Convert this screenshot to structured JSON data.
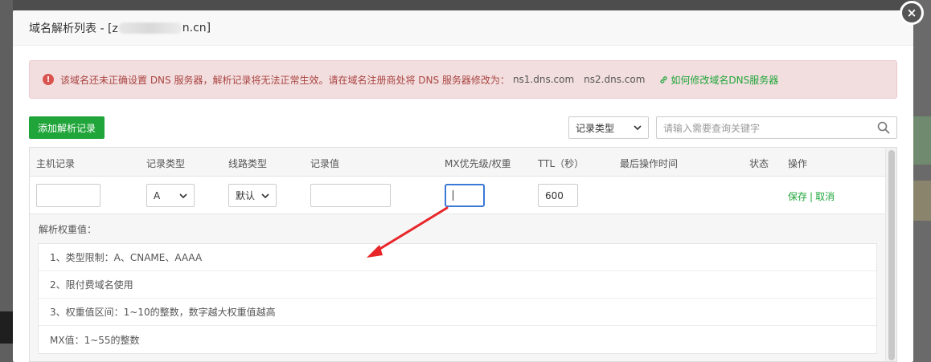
{
  "modal": {
    "title_prefix": "域名解析列表 - [z",
    "title_suffix": "n.cn]",
    "close_label": "×"
  },
  "alert": {
    "icon": "!",
    "message": "该域名还未正确设置 DNS 服务器，解析记录将无法正常生效。请在域名注册商处将 DNS 服务器修改为：",
    "ns1": "ns1.dns.com",
    "ns2": "ns2.dns.com",
    "help_link": "如何修改域名DNS服务器",
    "link_icon": "link-icon"
  },
  "toolbar": {
    "add_label": "添加解析记录",
    "type_select_value": "记录类型",
    "search_placeholder": "请输入需要查询关键字"
  },
  "table": {
    "headers": [
      "主机记录",
      "记录类型",
      "线路类型",
      "记录值",
      "MX优先级/权重",
      "TTL（秒）",
      "最后操作时间",
      "状态",
      "操作"
    ],
    "new_row": {
      "host": "",
      "type": "A",
      "line": "默认",
      "value": "",
      "mx": "",
      "ttl": "600",
      "save": "保存",
      "separator": "|",
      "cancel": "取消"
    }
  },
  "weight": {
    "title": "解析权重值：",
    "items": [
      "1、类型限制：A、CNAME、AAAA",
      "2、限付费域名使用",
      "3、权重值区间：1~10的整数，数字越大权重值越高",
      "MX值：1~55的整数"
    ]
  },
  "colors": {
    "accent_green": "#20a53a",
    "alert_bg": "#f2dede",
    "alert_text": "#a94442",
    "focus_blue": "#3b79d6",
    "annotation_red": "#e8262a"
  }
}
